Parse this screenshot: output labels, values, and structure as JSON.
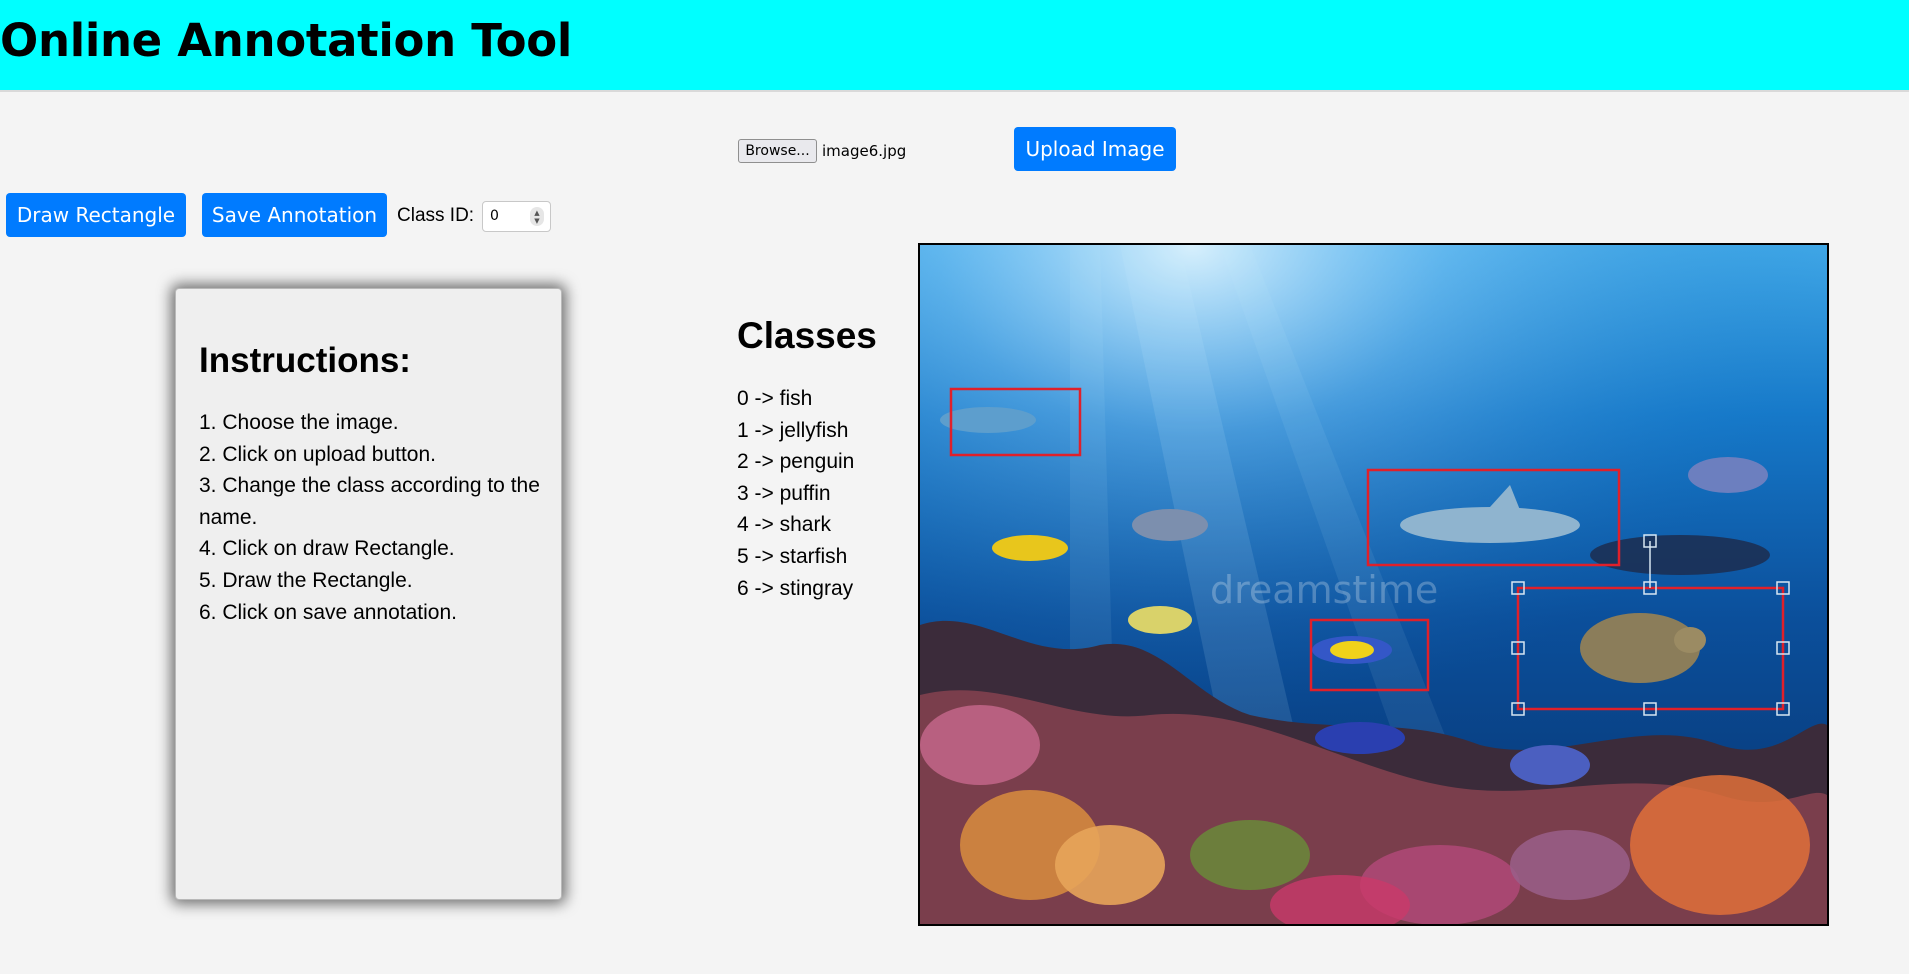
{
  "header": {
    "title": "Online Annotation Tool"
  },
  "upload": {
    "browse_label": "Browse...",
    "file_name": "image6.jpg",
    "upload_label": "Upload Image"
  },
  "toolbar": {
    "draw_label": "Draw Rectangle",
    "save_label": "Save Annotation",
    "class_id_label": "Class ID:",
    "class_id_value": "0"
  },
  "instructions": {
    "title": "Instructions:",
    "steps": [
      "1. Choose the image.",
      "2. Click on upload button.",
      "3. Change the class according to the name.",
      "4. Click on draw Rectangle.",
      "5. Draw the Rectangle.",
      "6. Click on save annotation."
    ]
  },
  "classes": {
    "title": "Classes",
    "items": [
      "0 -> fish",
      "1 -> jellyfish",
      "2 -> penguin",
      "3 -> puffin",
      "4 -> shark",
      "5 -> starfish",
      "6 -> stingray"
    ]
  },
  "canvas": {
    "watermark": "dreamstime",
    "annotation_color": "#e0202a",
    "accent": "#007bff",
    "header_bg": "#00ffff"
  }
}
